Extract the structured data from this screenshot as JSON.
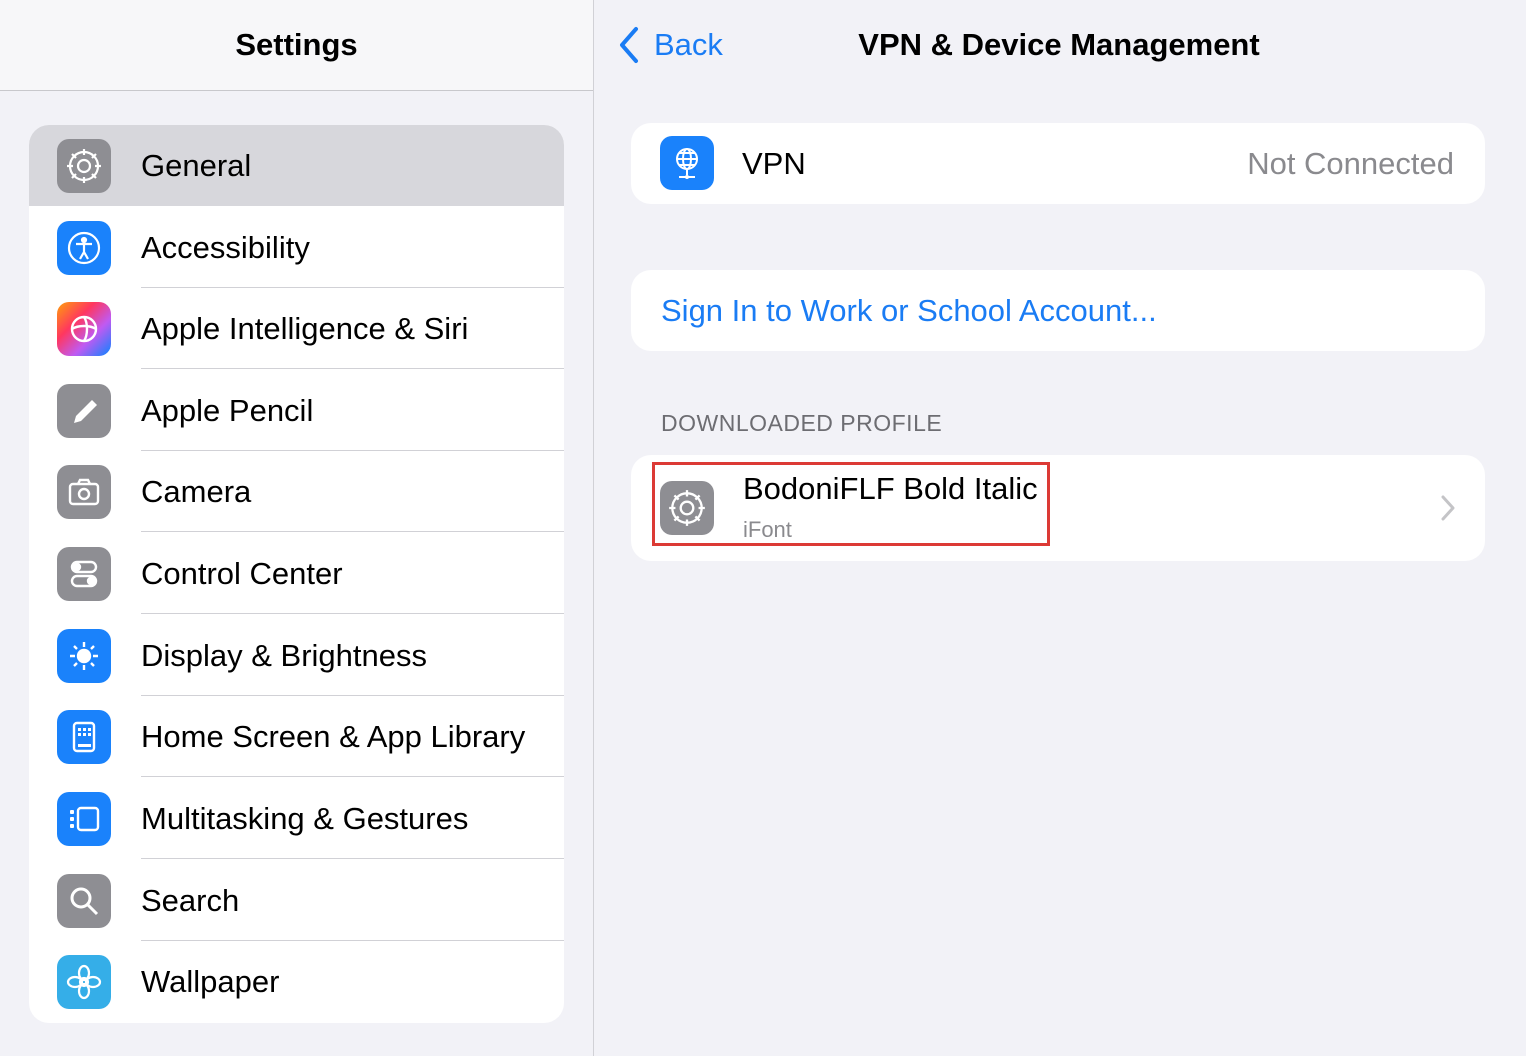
{
  "sidebar": {
    "title": "Settings",
    "items": [
      {
        "label": "General",
        "icon": "gear-icon",
        "selected": true
      },
      {
        "label": "Accessibility",
        "icon": "accessibility-icon"
      },
      {
        "label": "Apple Intelligence & Siri",
        "icon": "apple-intelligence-icon"
      },
      {
        "label": "Apple Pencil",
        "icon": "pencil-icon"
      },
      {
        "label": "Camera",
        "icon": "camera-icon"
      },
      {
        "label": "Control Center",
        "icon": "toggles-icon"
      },
      {
        "label": "Display & Brightness",
        "icon": "sun-icon"
      },
      {
        "label": "Home Screen & App Library",
        "icon": "home-screen-icon"
      },
      {
        "label": "Multitasking & Gestures",
        "icon": "multitasking-icon"
      },
      {
        "label": "Search",
        "icon": "magnifier-icon"
      },
      {
        "label": "Wallpaper",
        "icon": "flower-icon"
      }
    ]
  },
  "detail": {
    "back_label": "Back",
    "title": "VPN & Device Management",
    "vpn": {
      "label": "VPN",
      "status": "Not Connected",
      "icon": "globe-network-icon"
    },
    "signin_link": "Sign In to Work or School Account...",
    "section_header": "DOWNLOADED PROFILE",
    "profile": {
      "name": "BodoniFLF Bold Italic",
      "subtitle": "iFont",
      "icon": "gear-icon"
    }
  },
  "colors": {
    "accent": "#1a7cf4",
    "highlight": "#dc3a35",
    "background": "#f2f2f7"
  }
}
